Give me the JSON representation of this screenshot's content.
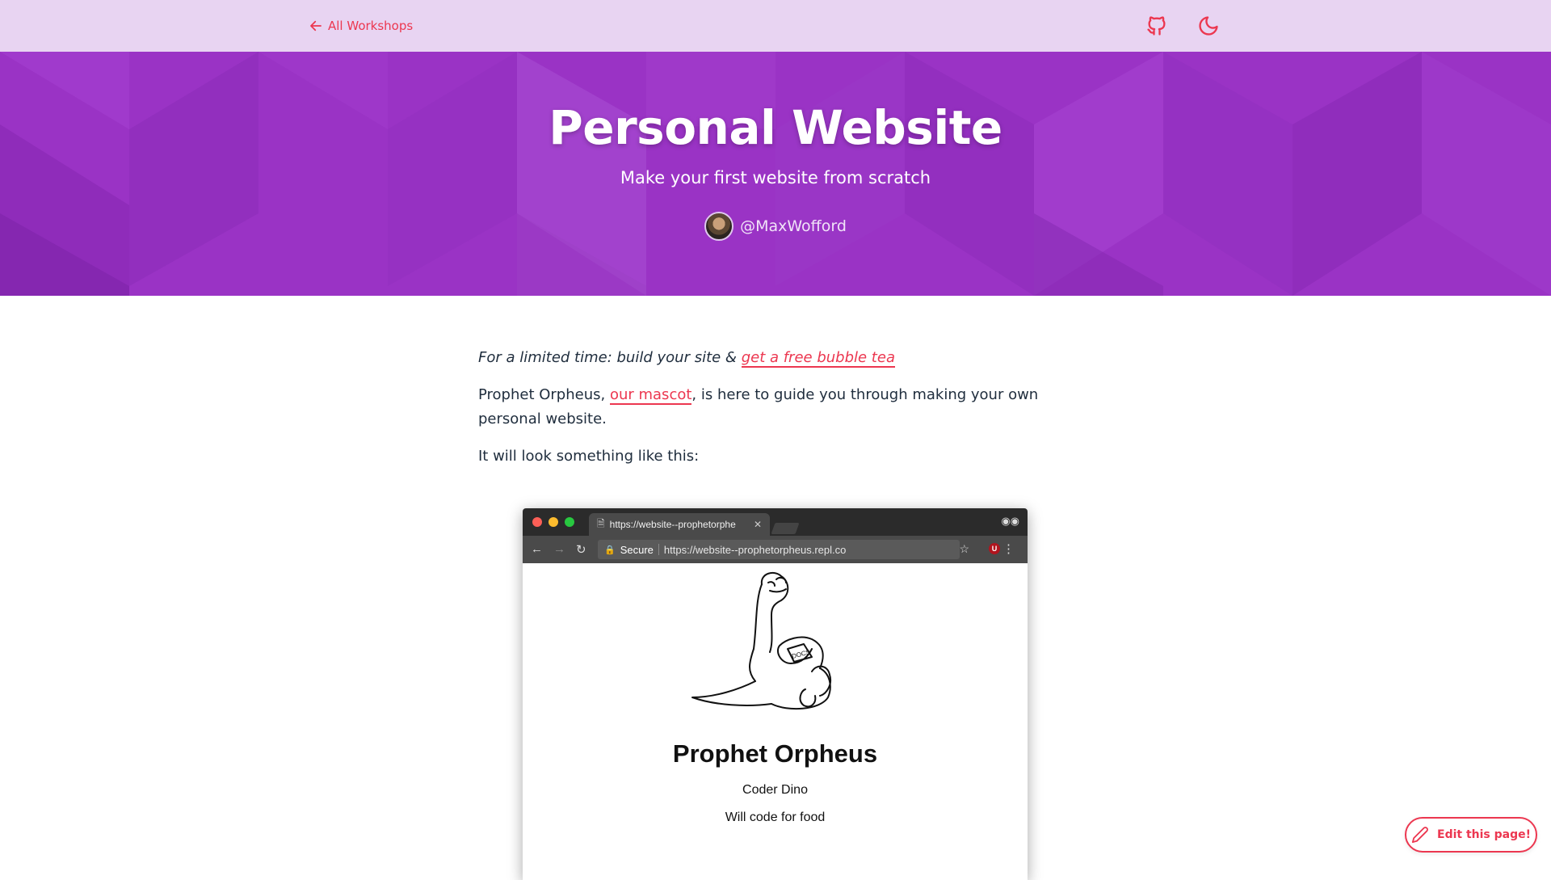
{
  "nav": {
    "back_label": "All Workshops",
    "github_icon": "github-icon",
    "theme_icon": "moon-icon"
  },
  "hero": {
    "title": "Personal Website",
    "subtitle": "Make your first website from scratch",
    "author": "@MaxWofford"
  },
  "content": {
    "promo_text": "For a limited time: build your site & ",
    "promo_link": "get a free bubble tea",
    "intro_before": "Prophet Orpheus, ",
    "intro_link": "our mascot",
    "intro_after": ", is here to guide you through making your own personal website.",
    "look_text": "It will look something like this:"
  },
  "screenshot": {
    "tab_title": "https://website--prophetorphe",
    "secure_label": "Secure",
    "url": "https://website--prophetorpheus.repl.co",
    "name": "Prophet Orpheus",
    "line1": "Coder Dino",
    "line2": "Will code for food",
    "notebook_text": "DOCS"
  },
  "edit_button": {
    "label": "Edit this page!",
    "icon": "pencil-icon"
  },
  "colors": {
    "accent": "#ec3750",
    "hero_bg": "#9a33c5",
    "nav_bg": "#e8d4f2"
  }
}
